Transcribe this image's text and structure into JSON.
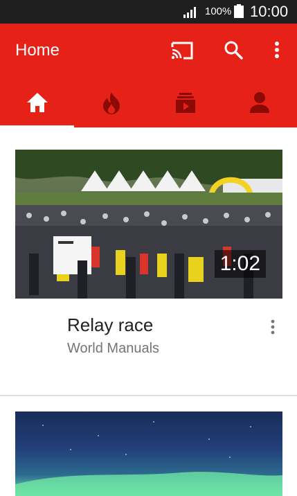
{
  "status_bar": {
    "battery_percent": "100%",
    "time": "10:00"
  },
  "app_bar": {
    "title": "Home",
    "icons": [
      "cast-icon",
      "search-icon",
      "more-vert-icon"
    ],
    "tabs": [
      {
        "name": "home",
        "icon": "home-icon",
        "active": true
      },
      {
        "name": "trending",
        "icon": "flame-icon",
        "active": false
      },
      {
        "name": "subscriptions",
        "icon": "subscriptions-icon",
        "active": false
      },
      {
        "name": "account",
        "icon": "person-icon",
        "active": false
      }
    ]
  },
  "colors": {
    "brand_red": "#e62117",
    "status_bar": "#1f1f1f"
  },
  "feed": {
    "videos": [
      {
        "title": "Relay race",
        "channel": "World Manuals",
        "duration": "1:02"
      }
    ]
  }
}
